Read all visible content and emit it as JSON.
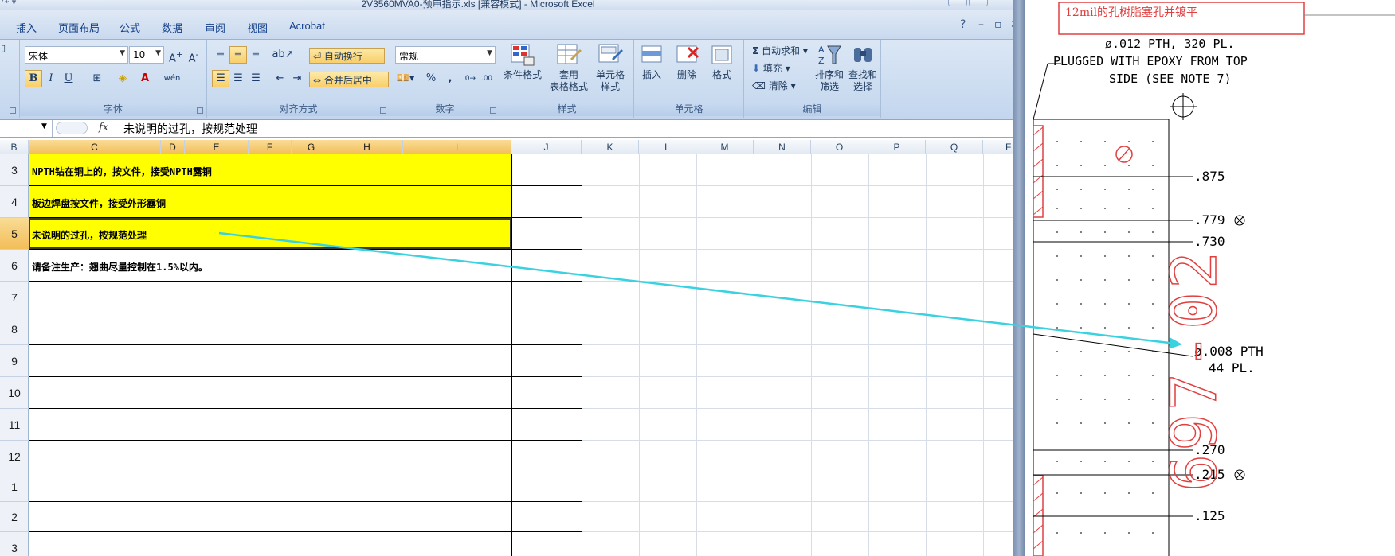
{
  "window": {
    "title": "2V3560MVA0-预审指示.xls  [兼容模式] - Microsoft Excel"
  },
  "menu": {
    "tabs": [
      "插入",
      "页面布局",
      "公式",
      "数据",
      "审阅",
      "视图",
      "Acrobat"
    ]
  },
  "ribbon": {
    "font_group": {
      "label": "字体",
      "font_name": "宋体",
      "font_size": "10",
      "bold": "B",
      "italic": "I",
      "underline": "U",
      "phonetic": "wén"
    },
    "alignment_group": {
      "label": "对齐方式",
      "wrap_text": "自动换行",
      "merge_center": "合并后居中"
    },
    "number_group": {
      "label": "数字",
      "format": "常规",
      "percent": "%",
      "comma": ","
    },
    "styles_group": {
      "label": "样式",
      "conditional_format": "条件格式",
      "format_as_table_1": "套用",
      "format_as_table_2": "表格格式",
      "cell_styles_1": "单元格",
      "cell_styles_2": "样式"
    },
    "cells_group": {
      "label": "单元格",
      "insert": "插入",
      "delete": "删除",
      "format": "格式"
    },
    "editing_group": {
      "label": "编辑",
      "autosum": "自动求和",
      "fill": "填充",
      "clear": "清除",
      "sort_filter_1": "排序和",
      "sort_filter_2": "筛选",
      "find_select_1": "查找和",
      "find_select_2": "选择"
    }
  },
  "formula_bar": {
    "fx": "fx",
    "content": "未说明的过孔，按规范处理"
  },
  "grid": {
    "columns": [
      "B",
      "C",
      "D",
      "E",
      "F",
      "G",
      "H",
      "I",
      "J",
      "K",
      "L",
      "M",
      "N",
      "O",
      "P",
      "Q",
      "F"
    ],
    "rows": [
      "3",
      "4",
      "5",
      "6",
      "7",
      "8",
      "9",
      "10",
      "11",
      "12",
      "1",
      "2",
      "3"
    ],
    "cells": {
      "r3": "NPTH钻在铜上的，按文件，接受NPTH露铜",
      "r4": "板边焊盘按文件，接受外形露铜",
      "r5": "未说明的过孔，按规范处理",
      "r6": "请备注生产：翘曲尽量控制在1.5%以内。"
    }
  },
  "cad": {
    "note_box": "12mil的孔树脂塞孔并镀平",
    "callout_1": "ø.012 PTH, 320 PL.",
    "callout_2": "PLUGGED WITH EPOXY FROM TOP",
    "callout_3": "SIDE (SEE NOTE 7)",
    "dims": [
      ".875",
      ".779",
      ".730",
      ".270",
      ".215",
      ".125"
    ],
    "callout_4": "ø.008 PTH",
    "callout_5": "44 PL.",
    "part_number": "697-02"
  },
  "colors": {
    "highlight": "#ffff00",
    "ribbon_bg": "#c9d9ee",
    "selection": "#f2be58",
    "arrow": "#3ad1e0",
    "cad_red": "#e04040"
  }
}
